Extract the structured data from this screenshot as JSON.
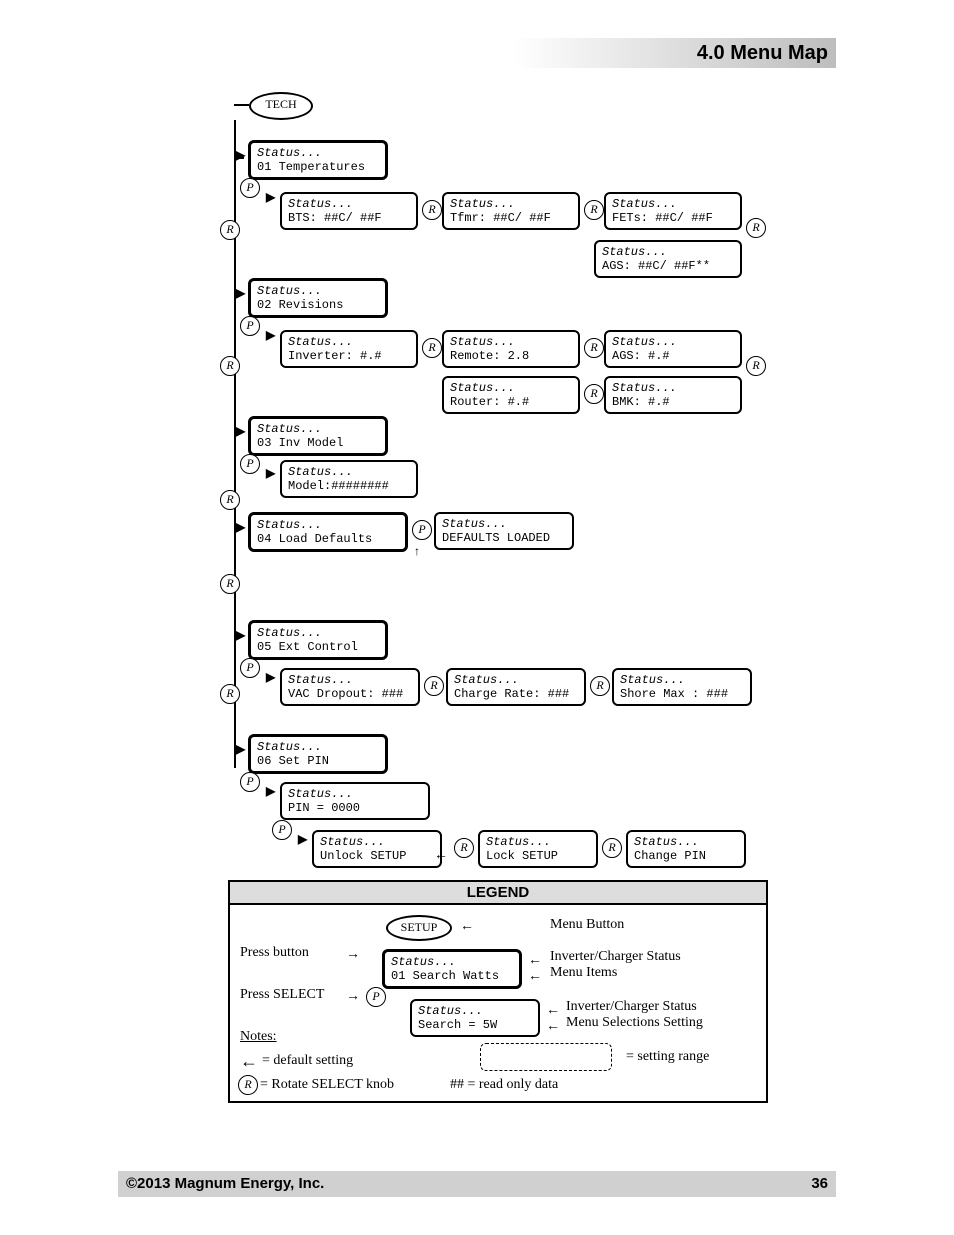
{
  "header": {
    "title": "4.0 Menu Map"
  },
  "footer": {
    "copyright": "©2013 Magnum Energy, Inc.",
    "page": "36"
  },
  "root_button": "TECH",
  "status_label": "Status...",
  "menus": {
    "m01": {
      "line2": "01 Temperatures",
      "items": {
        "bts": "BTS:    ##C/ ##F",
        "tfmr": "Tfmr:  ##C/ ##F",
        "fets": "FETs:   ##C/ ##F",
        "ags": "AGS:    ##C/ ##F**"
      }
    },
    "m02": {
      "line2": "02 Revisions",
      "items": {
        "inv": "Inverter:  #.#",
        "rem": "Remote:   2.8",
        "ags": "AGS:     #.#",
        "rtr": "Router:    #.#",
        "bmk": "BMK:     #.#"
      }
    },
    "m03": {
      "line2": "03 Inv Model",
      "items": {
        "model": "Model:########"
      }
    },
    "m04": {
      "line2": "04 Load Defaults",
      "items": {
        "loaded": "DEFAULTS LOADED"
      }
    },
    "m05": {
      "line2": "05 Ext Control",
      "items": {
        "vac": "VAC Dropout: ###",
        "chg": "Charge Rate: ###",
        "shore": "Shore Max  : ###"
      }
    },
    "m06": {
      "line2": "06 Set PIN",
      "items": {
        "pin": "PIN =       0000",
        "unlock": "Unlock SETUP",
        "lock": "Lock SETUP",
        "change": "Change PIN"
      }
    }
  },
  "legend": {
    "title": "LEGEND",
    "setup": "SETUP",
    "menu_button": "Menu Button",
    "press_button": "Press button",
    "press_select": "Press SELECT",
    "item_line2": "01 Search Watts",
    "sel_line2": "Search = 5W",
    "inv_status": "Inverter/Charger Status",
    "menu_items": "Menu Items",
    "menu_sel": "Menu Selections Setting",
    "notes": "Notes:",
    "default": "= default setting",
    "range": "= setting range",
    "rotate": "= Rotate SELECT knob",
    "readonly": "## = read only data"
  },
  "symbols": {
    "P": "P",
    "R": "R"
  }
}
